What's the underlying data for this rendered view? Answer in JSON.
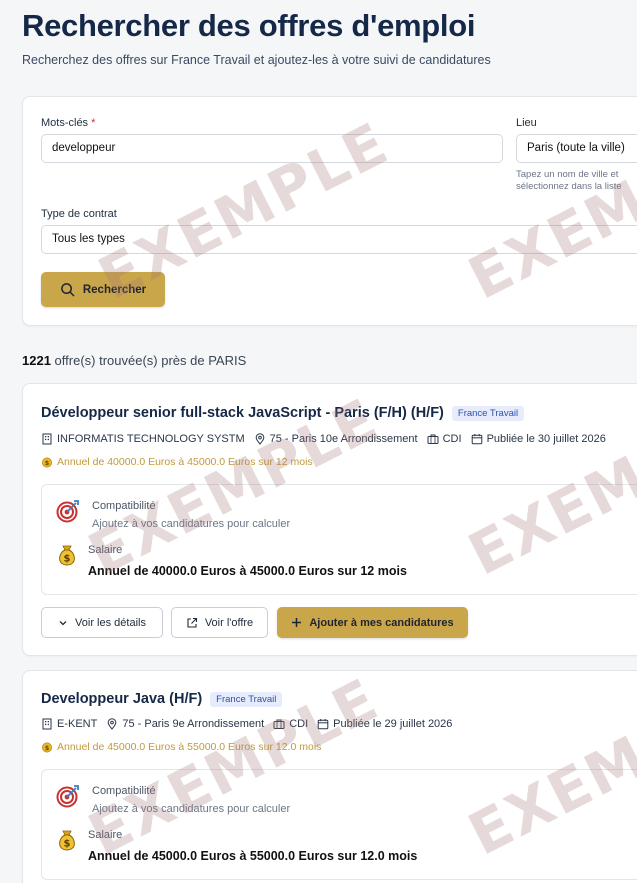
{
  "page": {
    "title": "Rechercher des offres d'emploi",
    "subtitle": "Recherchez des offres sur France Travail et ajoutez-les à votre suivi de candidatures"
  },
  "search": {
    "keywords_label": "Mots-clés",
    "required_mark": "*",
    "keywords_value": "developpeur",
    "location_label": "Lieu",
    "location_value": "Paris (toute la ville)",
    "location_hint": "Tapez un nom de ville et sélectionnez dans la liste",
    "contract_label": "Type de contrat",
    "contract_value": "Tous les types",
    "search_button": "Rechercher"
  },
  "results": {
    "count": "1221",
    "text": "offre(s) trouvée(s) près de PARIS"
  },
  "jobs": [
    {
      "title": "Développeur senior full-stack JavaScript - Paris (F/H) (H/F)",
      "source": "France Travail",
      "company": "INFORMATIS TECHNOLOGY SYSTM",
      "location": "75 - Paris 10e Arrondissement",
      "contract": "CDI",
      "published": "Publiée le 30 juillet 2026",
      "salary_short": "Annuel de 40000.0 Euros à 45000.0 Euros sur 12 mois",
      "compat_label": "Compatibilité",
      "compat_hint": "Ajoutez à vos candidatures pour calculer",
      "salary_label": "Salaire",
      "salary_value": "Annuel de 40000.0 Euros à 45000.0 Euros sur 12 mois",
      "details_button": "Voir les détails",
      "offer_button": "Voir l'offre",
      "add_button": "Ajouter à mes candidatures"
    },
    {
      "title": "Developpeur Java (H/F)",
      "source": "France Travail",
      "company": "E-KENT",
      "location": "75 - Paris 9e Arrondissement",
      "contract": "CDI",
      "published": "Publiée le 29 juillet 2026",
      "salary_short": "Annuel de 45000.0 Euros à 55000.0 Euros sur 12.0 mois",
      "compat_label": "Compatibilité",
      "compat_hint": "Ajoutez à vos candidatures pour calculer",
      "salary_label": "Salaire",
      "salary_value": "Annuel de 45000.0 Euros à 55000.0 Euros sur 12.0 mois"
    }
  ],
  "watermark": "EXEMPLE",
  "colors": {
    "accent_gold": "#c9a64a",
    "title_navy": "#152848",
    "badge_blue": "#2e4fb0",
    "salary_gold": "#c09a3a"
  }
}
